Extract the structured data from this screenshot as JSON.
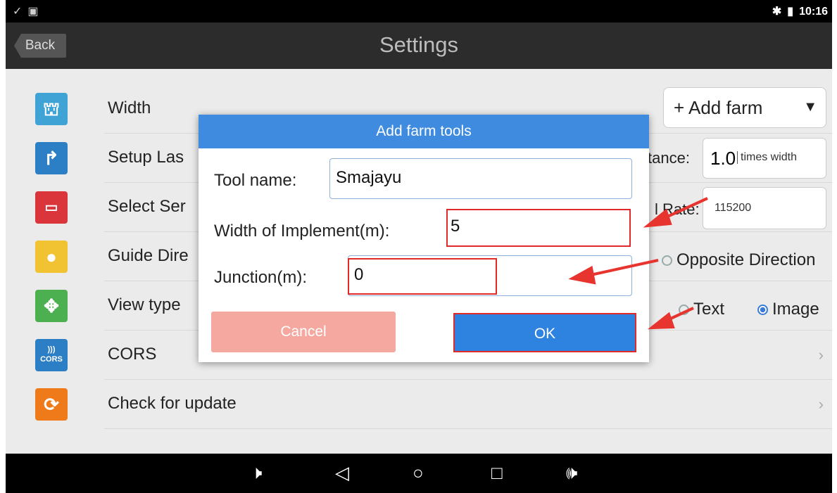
{
  "status_bar": {
    "left_icons": [
      "check-icon",
      "image-icon"
    ],
    "time": "10:16",
    "right_icons": [
      "bluetooth-icon",
      "battery-icon"
    ]
  },
  "title_bar": {
    "back_label": "Back",
    "title": "Settings"
  },
  "settings_rows": [
    {
      "label": "Width",
      "icon": "implement-icon",
      "color": "#3fa3d6"
    },
    {
      "label": "Setup Las",
      "icon": "path-icon",
      "color": "#2c7fc4"
    },
    {
      "label": "Select Ser",
      "icon": "serial-port-icon",
      "color": "#d9353a"
    },
    {
      "label": "Guide Dire",
      "icon": "direction-icon",
      "color": "#f1c232"
    },
    {
      "label": "View type",
      "icon": "view-icon",
      "color": "#4caf50"
    },
    {
      "label": "CORS",
      "icon": "cors-icon",
      "color": "#2c7fc4",
      "icon_text": "CORS"
    },
    {
      "label": "Check for update",
      "icon": "update-icon",
      "color": "#ef7a1a"
    }
  ],
  "add_farm": {
    "label": "+ Add farm"
  },
  "distance": {
    "label": "tance:",
    "value": "1.0",
    "unit": "times width"
  },
  "baud_rate": {
    "label": "l Rate:",
    "value": "115200"
  },
  "guide_direction": {
    "option": "Opposite Direction"
  },
  "view_type": {
    "options": [
      "Text",
      "Image"
    ],
    "selected": "Image"
  },
  "dialog": {
    "title": "Add farm tools",
    "tool_name_label": "Tool name:",
    "tool_name_value": "Smajayu",
    "width_label": "Width of Implement(m):",
    "width_value": "5",
    "junction_label": "Junction(m):",
    "junction_value": "0",
    "cancel_label": "Cancel",
    "ok_label": "OK"
  },
  "nav_bar": {
    "icons": [
      "volume-down-icon",
      "back-icon",
      "home-icon",
      "recents-icon",
      "volume-up-icon"
    ]
  },
  "colors": {
    "dialog_header": "#3e8be0",
    "ok_button": "#2f83e0",
    "cancel_button": "#f4a8a0",
    "highlight": "#e02a2a"
  }
}
